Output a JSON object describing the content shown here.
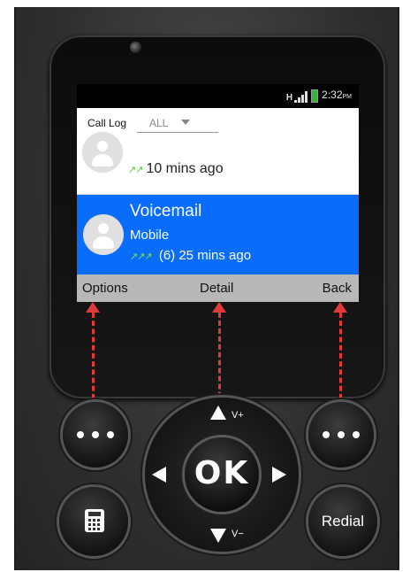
{
  "status": {
    "time": "2:32",
    "ampm": "PM",
    "network": "H"
  },
  "header": {
    "title": "Call Log",
    "filter_value": "ALL"
  },
  "calls": [
    {
      "name": "",
      "time": "10 mins ago",
      "arrow_glyph": "↗↗",
      "contact_type": ""
    },
    {
      "name": "Voicemail",
      "contact_type": "Mobile",
      "count": "(6)",
      "time": "25 mins ago",
      "arrow_glyph": "↗↗↗",
      "selected": true
    }
  ],
  "softkeys": {
    "left": "Options",
    "middle": "Detail",
    "right": "Back"
  },
  "keypad": {
    "ok_label": "OK",
    "volume_up_label": "V+",
    "volume_down_label": "V−",
    "redial_label": "Redial"
  },
  "colors": {
    "selected_row": "#0a6dfa",
    "softbar": "#b8b8b8",
    "annotation_arrow": "#e03a3a",
    "call_arrow": "#6cc24a"
  }
}
